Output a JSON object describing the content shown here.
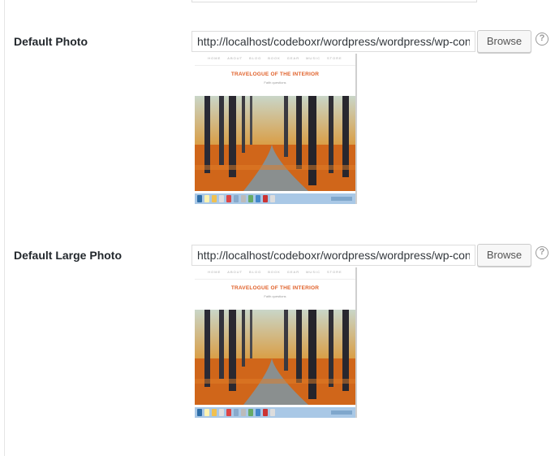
{
  "fields": [
    {
      "label": "Default Photo",
      "value": "http://localhost/codeboxr/wordpress/wordpress/wp-content/uploads/default-photo.png",
      "browse_label": "Browse",
      "help_glyph": "?",
      "help_icon": "question-circle-icon"
    },
    {
      "label": "Default Large Photo",
      "value": "http://localhost/codeboxr/wordpress/wordpress/wp-content/uploads/default-large-photo.png",
      "browse_label": "Browse",
      "help_glyph": "?",
      "help_icon": "question-circle-icon"
    }
  ],
  "preview": {
    "nav_items": [
      "HOME",
      "ABOUT",
      "BLOG",
      "BOOK",
      "GEAR",
      "MUSIC",
      "STORE"
    ],
    "title": "TRAVELOGUE OF THE INTERIOR",
    "subtitle": "Faith questions"
  }
}
